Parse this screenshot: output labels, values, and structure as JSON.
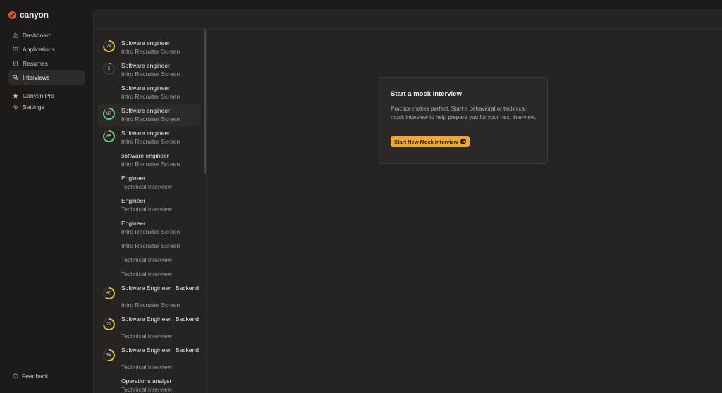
{
  "brand": {
    "name": "canyon",
    "color": "#e5502f"
  },
  "nav": {
    "items": [
      {
        "label": "Dashboard",
        "icon": "home-icon"
      },
      {
        "label": "Applications",
        "icon": "grid-icon"
      },
      {
        "label": "Resumes",
        "icon": "document-icon"
      },
      {
        "label": "Interviews",
        "icon": "chat-icon",
        "active": true
      }
    ],
    "secondary": [
      {
        "label": "Canyon Pro",
        "icon": "star-icon"
      },
      {
        "label": "Settings",
        "icon": "gear-icon"
      }
    ],
    "feedback": "Feedback"
  },
  "interviews": [
    {
      "title": "Software engineer",
      "subtitle": "Intro Recruiter Screen",
      "score": "73",
      "progress": 0.73,
      "color": "#e8c441"
    },
    {
      "title": "Software engineer",
      "subtitle": "Intro Recruiter Screen",
      "score": "5",
      "progress": 0.05,
      "color": "#e89a3a"
    },
    {
      "title": "Software engineer",
      "subtitle": "Intro Recruiter Screen"
    },
    {
      "title": "Software engineer",
      "subtitle": "Intro Recruiter Screen",
      "score": "87",
      "progress": 0.87,
      "color": "#5fcf7a",
      "highlight": true
    },
    {
      "title": "Software engineer",
      "subtitle": "Intro Recruiter Screen",
      "score": "85",
      "progress": 0.85,
      "color": "#5fcf7a"
    },
    {
      "title": "software engineer",
      "subtitle": "Intro Recruiter Screen"
    },
    {
      "title": "Engineer",
      "subtitle": "Technical Interview"
    },
    {
      "title": "Engineer",
      "subtitle": "Technical Interview"
    },
    {
      "title": "Engineer",
      "subtitle": "Intro Recruiter Screen"
    },
    {
      "title": "",
      "subtitle": "Intro Recruiter Screen"
    },
    {
      "title": "",
      "subtitle": "Technical Interview"
    },
    {
      "title": "",
      "subtitle": "Technical Interview"
    },
    {
      "title": "Software Engineer | Backend",
      "subtitle": "Intro Recruiter Screen",
      "score": "60",
      "progress": 0.6,
      "color": "#e8c441"
    },
    {
      "title": "Software Engineer | Backend",
      "subtitle": "Technical Interview",
      "score": "72",
      "progress": 0.72,
      "color": "#e8c441"
    },
    {
      "title": "Software Engineer | Backend",
      "subtitle": "Technical Interview",
      "score": "54",
      "progress": 0.54,
      "color": "#e8c441"
    },
    {
      "title": "Operations analyst",
      "subtitle": "Technical Interview"
    }
  ],
  "mock_card": {
    "title": "Start a mock interview",
    "body": "Practice makes perfect. Start a behavioral or technical mock interview to help prepare you for your next interview.",
    "cta": "Start New Mock Interview",
    "cta_color": "#f0a830"
  }
}
